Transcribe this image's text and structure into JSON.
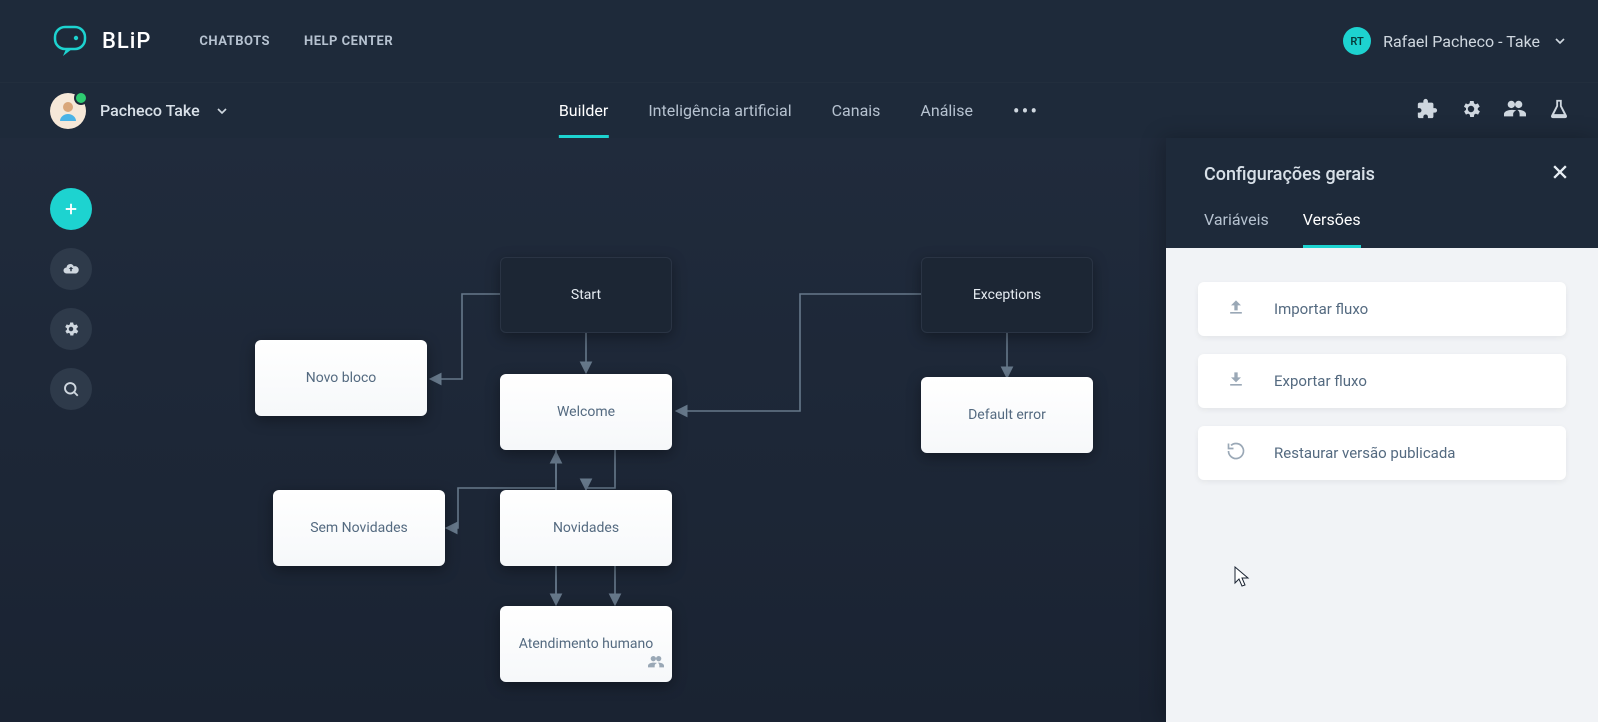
{
  "header": {
    "brand": "BLiP",
    "nav": {
      "chatbots": "CHATBOTS",
      "help_center": "HELP CENTER"
    },
    "user": {
      "initials": "RT",
      "name": "Rafael Pacheco - Take"
    }
  },
  "subheader": {
    "bot_name": "Pacheco Take",
    "tabs": {
      "builder": "Builder",
      "ai": "Inteligência artificial",
      "channels": "Canais",
      "analysis": "Análise"
    }
  },
  "flow": {
    "nodes": {
      "start": "Start",
      "exceptions": "Exceptions",
      "novo_bloco": "Novo bloco",
      "welcome": "Welcome",
      "default_error": "Default error",
      "sem_novidades": "Sem Novidades",
      "novidades": "Novidades",
      "atendimento": "Atendimento humano"
    }
  },
  "panel": {
    "title": "Configurações gerais",
    "tabs": {
      "variables": "Variáveis",
      "versions": "Versões"
    },
    "actions": {
      "import": "Importar fluxo",
      "export": "Exportar fluxo",
      "restore": "Restaurar versão publicada"
    }
  }
}
